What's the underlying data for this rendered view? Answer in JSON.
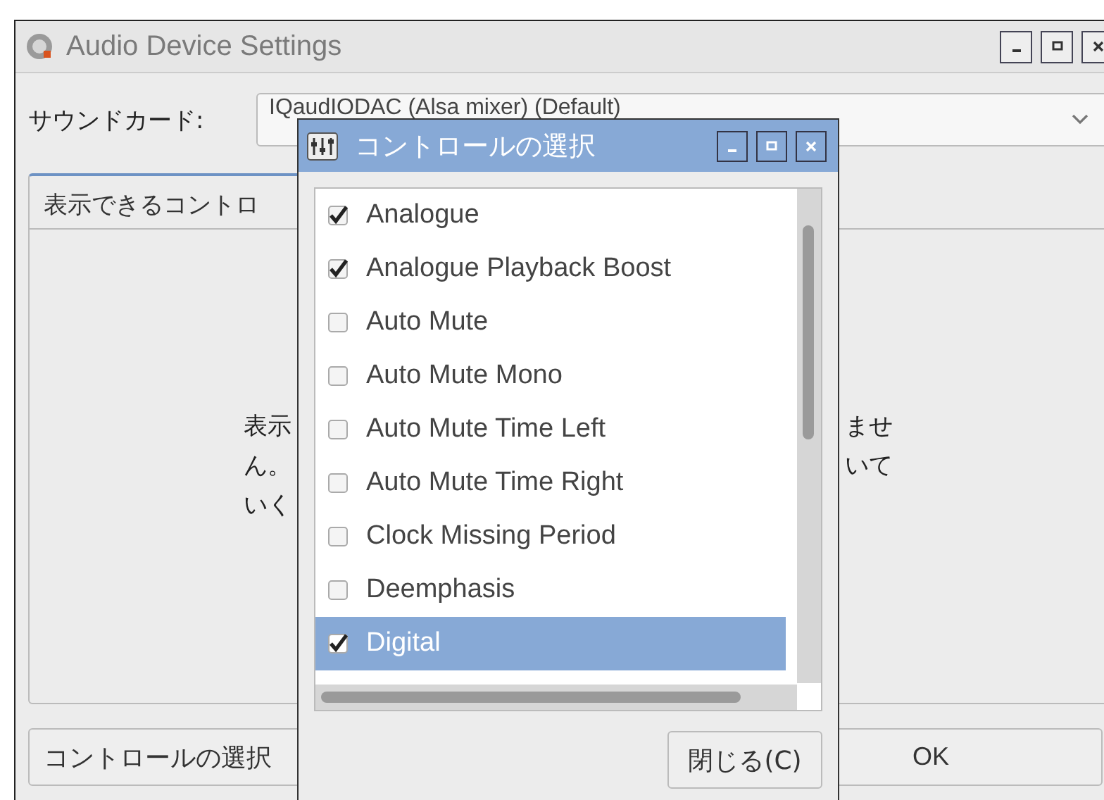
{
  "main_window": {
    "title": "Audio Device Settings",
    "sound_card": {
      "label": "サウンドカード:",
      "value": "IQaudIODAC (Alsa mixer) (Default)"
    },
    "panel": {
      "tab_label": "表示できるコントロ",
      "message_left": [
        "表示",
        "ん。",
        "いく"
      ],
      "message_right": [
        "ませ",
        "いて"
      ]
    },
    "buttons": [
      "コントロールの選択",
      "OK"
    ]
  },
  "dialog": {
    "title": "コントロールの選択",
    "items": [
      {
        "label": "Analogue",
        "checked": true,
        "selected": false
      },
      {
        "label": "Analogue Playback Boost",
        "checked": true,
        "selected": false
      },
      {
        "label": "Auto Mute",
        "checked": false,
        "selected": false
      },
      {
        "label": "Auto Mute Mono",
        "checked": false,
        "selected": false
      },
      {
        "label": "Auto Mute Time Left",
        "checked": false,
        "selected": false
      },
      {
        "label": "Auto Mute Time Right",
        "checked": false,
        "selected": false
      },
      {
        "label": "Clock Missing Period",
        "checked": false,
        "selected": false
      },
      {
        "label": "Deemphasis",
        "checked": false,
        "selected": false
      },
      {
        "label": "Digital",
        "checked": true,
        "selected": true
      }
    ],
    "close_button": "閉じる(C)"
  }
}
